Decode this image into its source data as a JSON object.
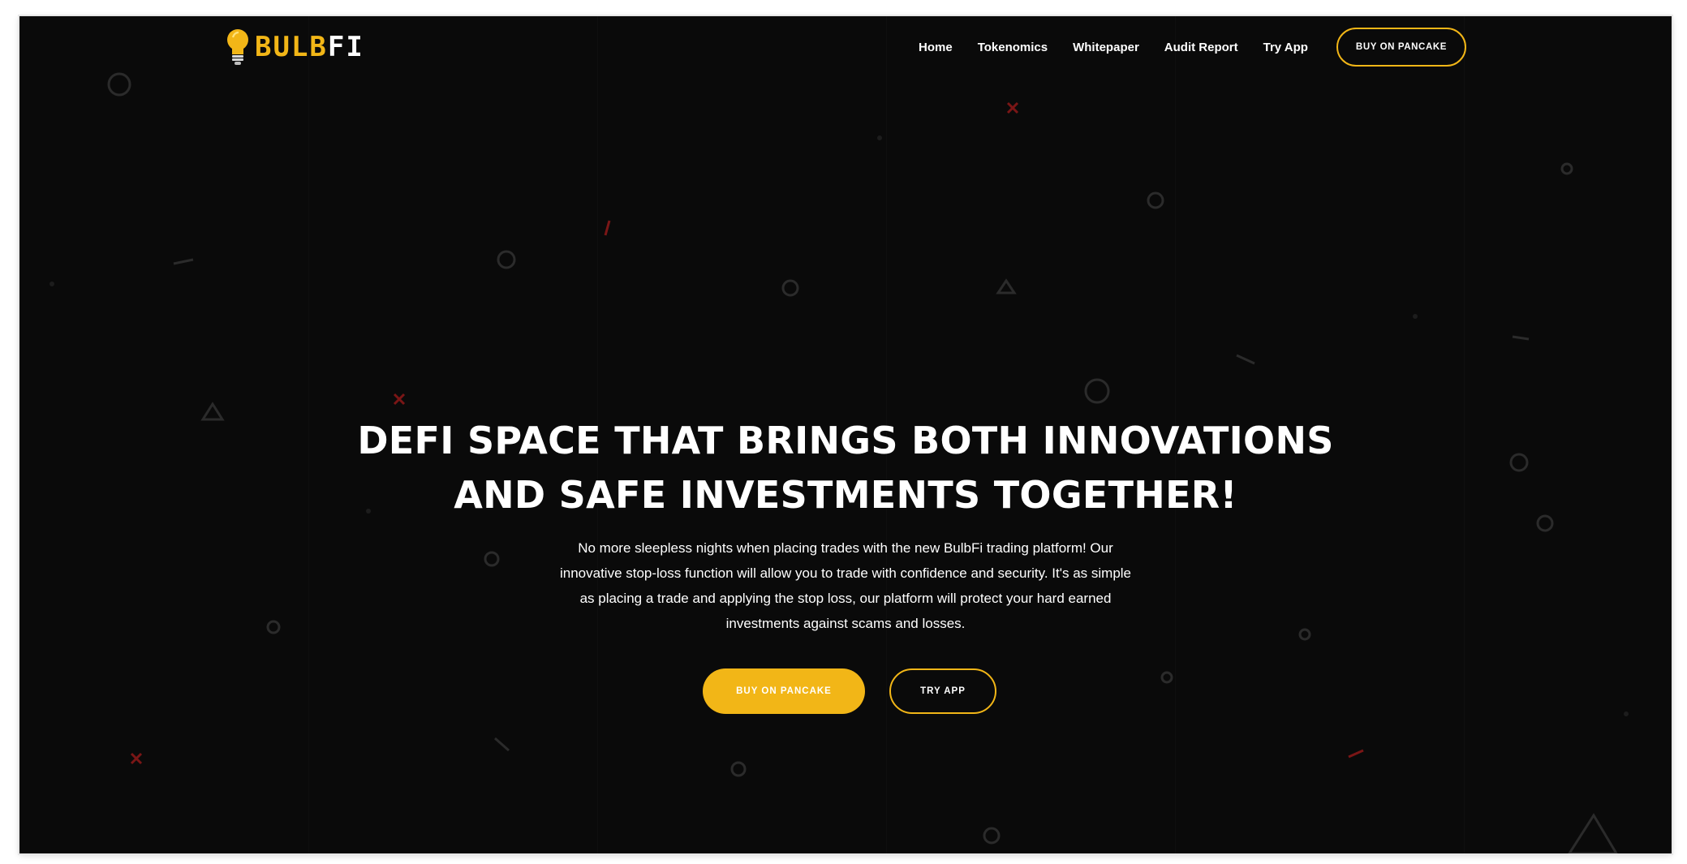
{
  "logo": {
    "bulb_text": "BULB",
    "fi_text": "FI",
    "icon": "lightbulb-icon"
  },
  "nav": {
    "items": [
      {
        "label": "Home"
      },
      {
        "label": "Tokenomics"
      },
      {
        "label": "Whitepaper"
      },
      {
        "label": "Audit Report"
      },
      {
        "label": "Try App"
      }
    ],
    "cta_label": "BUY ON PANCAKE"
  },
  "hero": {
    "title_line1": "DEFI SPACE THAT BRINGS BOTH INNOVATIONS",
    "title_line2": "AND SAFE INVESTMENTS TOGETHER!",
    "description": "No more sleepless nights when placing trades with the new BulbFi trading platform! Our innovative stop-loss function will allow you to trade with confidence and security. It's as simple as placing a trade and applying the stop loss, our platform will protect your hard earned investments against scams and losses.",
    "primary_button": "BUY ON PANCAKE",
    "secondary_button": "TRY APP"
  },
  "colors": {
    "background": "#0a0a0a",
    "accent": "#f2b617",
    "text": "#ffffff",
    "decor_red": "#8b1a1a",
    "decor_gray": "#2a2a2a"
  }
}
